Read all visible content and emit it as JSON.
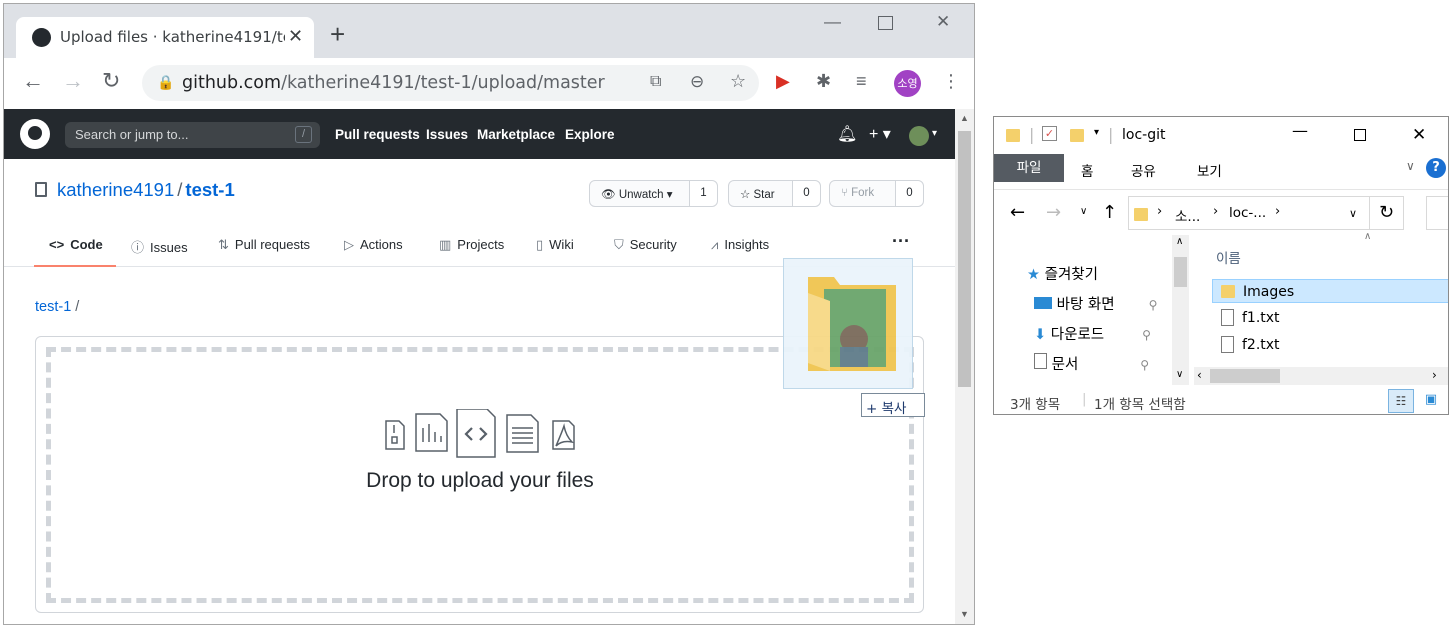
{
  "browser": {
    "tab_title": "Upload files · katherine4191/test-1",
    "url_domain": "github.com",
    "url_path": "/katherine4191/test-1/upload/master",
    "profile_initials": "소영"
  },
  "github": {
    "search_placeholder": "Search or jump to...",
    "search_shortcut": "/",
    "nav": [
      "Pull requests",
      "Issues",
      "Marketplace",
      "Explore"
    ],
    "owner": "katherine4191",
    "repo": "test-1",
    "watch_label": "Unwatch",
    "watch_count": "1",
    "star_label": "Star",
    "star_count": "0",
    "fork_label": "Fork",
    "fork_count": "0",
    "tabs": [
      "Code",
      "Issues",
      "Pull requests",
      "Actions",
      "Projects",
      "Wiki",
      "Security",
      "Insights"
    ],
    "breadcrumb_repo": "test-1",
    "breadcrumb_sep": "/",
    "drop_text": "Drop to upload your files",
    "copy_badge": "+ 복사"
  },
  "explorer": {
    "title": "loc-git",
    "ribbon_file": "파일",
    "ribbon_tabs": [
      "홈",
      "공유",
      "보기"
    ],
    "address_parts": [
      "소...",
      "loc-..."
    ],
    "column_header": "이름",
    "nav_items": [
      {
        "label": "즐겨찾기",
        "icon": "star-icon"
      },
      {
        "label": "바탕 화면",
        "icon": "desktop-icon"
      },
      {
        "label": "다운로드",
        "icon": "download-icon"
      },
      {
        "label": "문서",
        "icon": "document-icon"
      }
    ],
    "files": [
      {
        "label": "Images",
        "type": "folder",
        "selected": true
      },
      {
        "label": "f1.txt",
        "type": "text"
      },
      {
        "label": "f2.txt",
        "type": "text"
      }
    ],
    "status_count": "3개 항목",
    "status_selected": "1개 항목 선택함"
  }
}
